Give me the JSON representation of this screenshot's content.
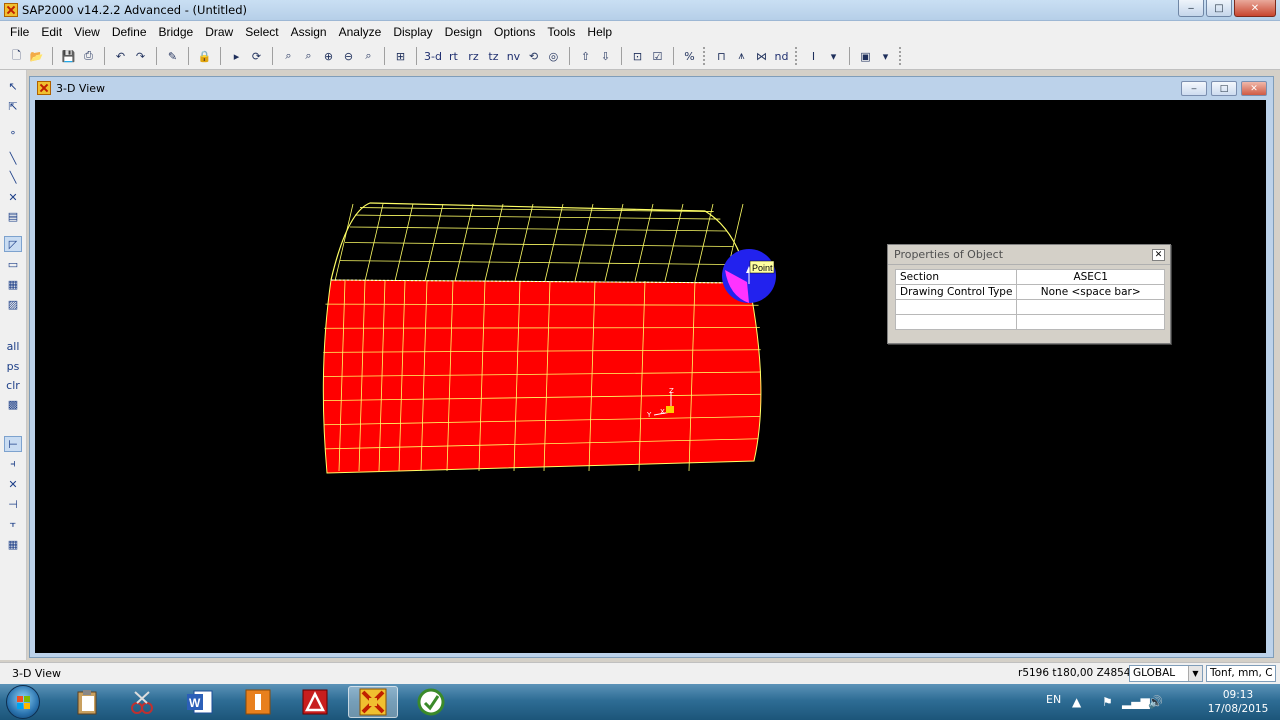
{
  "window": {
    "title": "SAP2000 v14.2.2 Advanced  - (Untitled)",
    "controls": {
      "minimize": "‒",
      "maximize": "□",
      "close": "✕"
    }
  },
  "menu": [
    "File",
    "Edit",
    "View",
    "Define",
    "Bridge",
    "Draw",
    "Select",
    "Assign",
    "Analyze",
    "Display",
    "Design",
    "Options",
    "Tools",
    "Help"
  ],
  "toolbar": {
    "view_buttons": [
      "3-d",
      "rt",
      "rz",
      "tz",
      "nv"
    ],
    "nd_label": "nd"
  },
  "view_window": {
    "title": "3-D View",
    "model_label": "Point",
    "axis_labels": {
      "z": "Z",
      "x": "X",
      "y": "Y"
    },
    "colors": {
      "shell": "#ff0000",
      "mesh": "#ffff66",
      "highlight": "#2222ee",
      "background": "#000000"
    }
  },
  "properties_panel": {
    "title": "Properties of Object",
    "close": "✕",
    "rows": [
      {
        "label": "Section",
        "value": "ASEC1"
      },
      {
        "label": "Drawing Control Type",
        "value": "None  <space bar>"
      },
      {
        "label": "",
        "value": ""
      },
      {
        "label": "",
        "value": ""
      }
    ]
  },
  "statusbar": {
    "view_name": "3-D View",
    "coords": "r5196  t180,00  Z4854",
    "coord_system": "GLOBAL",
    "units": "Tonf, mm, C"
  },
  "taskbar": {
    "language": "EN",
    "time": "09:13",
    "date": "17/08/2015"
  }
}
